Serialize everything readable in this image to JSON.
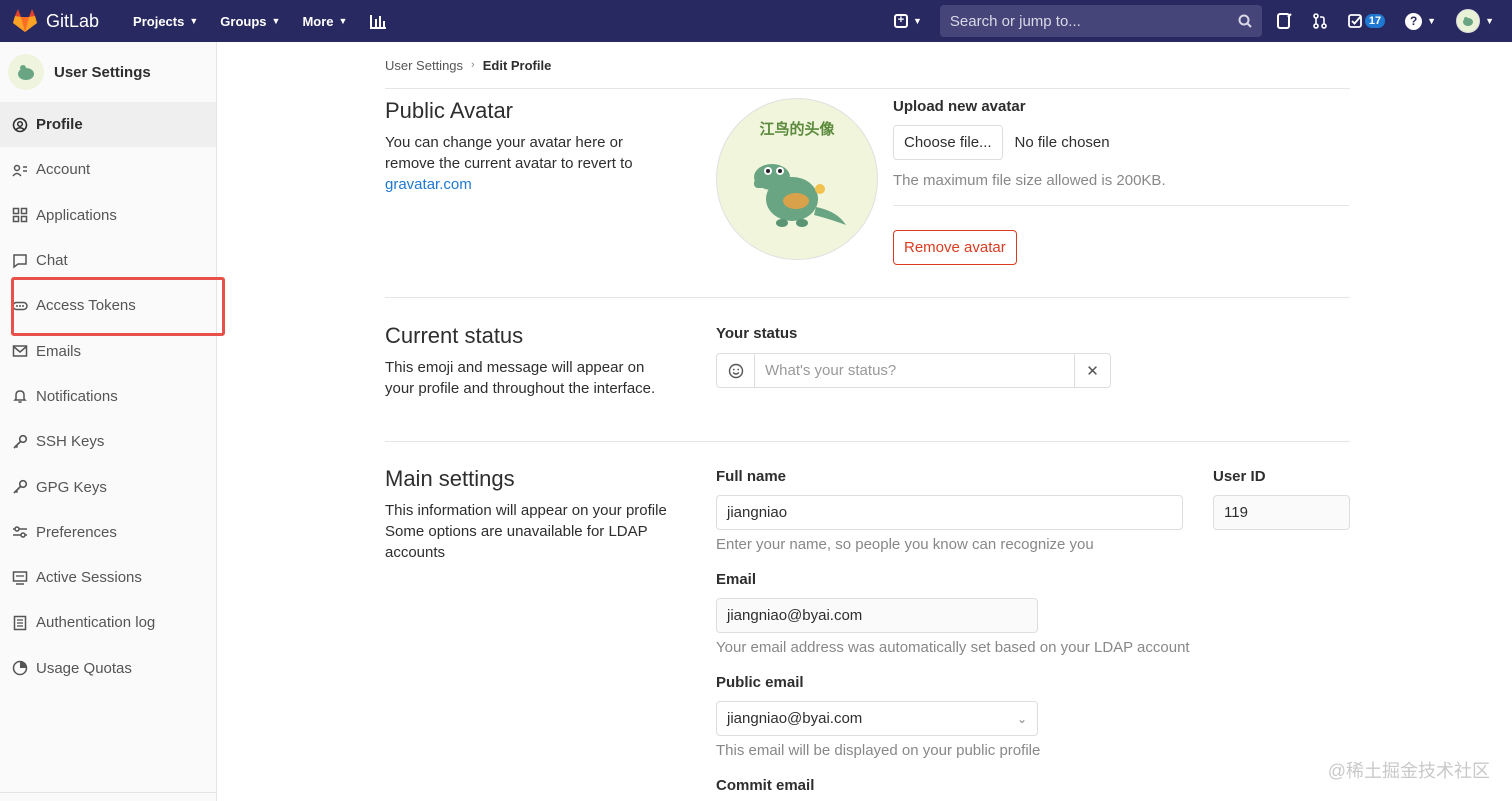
{
  "topbar": {
    "brand": "GitLab",
    "nav": [
      {
        "label": "Projects"
      },
      {
        "label": "Groups"
      },
      {
        "label": "More"
      }
    ],
    "search_placeholder": "Search or jump to...",
    "todo_count": "17"
  },
  "sidebar": {
    "title": "User Settings",
    "items": [
      {
        "label": "Profile",
        "icon": "profile-icon"
      },
      {
        "label": "Account",
        "icon": "account-icon"
      },
      {
        "label": "Applications",
        "icon": "applications-icon"
      },
      {
        "label": "Chat",
        "icon": "chat-icon"
      },
      {
        "label": "Access Tokens",
        "icon": "token-icon"
      },
      {
        "label": "Emails",
        "icon": "mail-icon"
      },
      {
        "label": "Notifications",
        "icon": "bell-icon"
      },
      {
        "label": "SSH Keys",
        "icon": "key-icon"
      },
      {
        "label": "GPG Keys",
        "icon": "key-icon"
      },
      {
        "label": "Preferences",
        "icon": "preferences-icon"
      },
      {
        "label": "Active Sessions",
        "icon": "monitor-icon"
      },
      {
        "label": "Authentication log",
        "icon": "log-icon"
      },
      {
        "label": "Usage Quotas",
        "icon": "quota-icon"
      }
    ],
    "active_index": 0
  },
  "breadcrumb": {
    "parent": "User Settings",
    "current": "Edit Profile"
  },
  "avatar_section": {
    "title": "Public Avatar",
    "desc_prefix": "You can change your avatar here or remove the current avatar to revert to ",
    "desc_link": "gravatar.com",
    "avatar_text": "江鸟的头像",
    "upload_label": "Upload new avatar",
    "choose_file": "Choose file...",
    "no_file": "No file chosen",
    "max_size_hint": "The maximum file size allowed is 200KB.",
    "remove_button": "Remove avatar"
  },
  "status_section": {
    "title": "Current status",
    "desc": "This emoji and message will appear on your profile and throughout the interface.",
    "label": "Your status",
    "placeholder": "What's your status?"
  },
  "main_settings": {
    "title": "Main settings",
    "desc_line1": "This information will appear on your profile",
    "desc_line2": "Some options are unavailable for LDAP accounts",
    "full_name_label": "Full name",
    "full_name_value": "jiangniao",
    "full_name_hint": "Enter your name, so people you know can recognize you",
    "user_id_label": "User ID",
    "user_id_value": "119",
    "email_label": "Email",
    "email_value": "jiangniao@byai.com",
    "email_hint": "Your email address was automatically set based on your LDAP account",
    "public_email_label": "Public email",
    "public_email_value": "jiangniao@byai.com",
    "public_email_hint": "This email will be displayed on your public profile",
    "commit_email_label": "Commit email"
  },
  "watermark": "@稀土掘金技术社区",
  "colors": {
    "topbar": "#292961",
    "link": "#1f78d1",
    "danger": "#db3b21",
    "highlight": "#e8504a"
  }
}
